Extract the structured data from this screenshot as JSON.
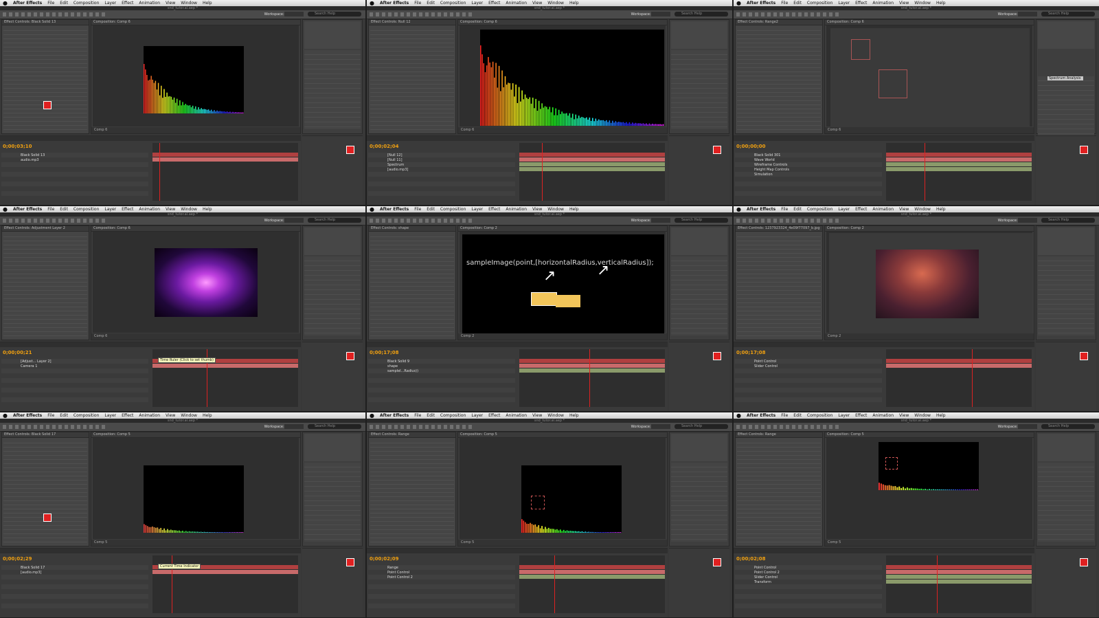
{
  "menu": {
    "app_name": "After Effects",
    "items": [
      "File",
      "Edit",
      "Composition",
      "Layer",
      "Effect",
      "Animation",
      "View",
      "Window",
      "Help"
    ]
  },
  "window_title": "snd_tutor.al.aep *",
  "workspace": "Workspace: Standard",
  "search_placeholder": "Search Help",
  "tiles": [
    {
      "left_tab": "Effect Controls: Black Solid 13",
      "comp_tab": "Composition: Comp 6",
      "comp_name": "Comp 6",
      "timecode": "0;00;03;10",
      "layers": [
        "Black Solid 13",
        "audio.mp3"
      ],
      "viewer": "spectrum-small"
    },
    {
      "left_tab": "Effect Controls: Null 12",
      "comp_tab": "Composition: Comp 6",
      "comp_name": "Comp 6",
      "timecode": "0;00;02;04",
      "layers": [
        "[Null 12]",
        "[Null 11]",
        "Spectrum",
        "[audio.mp3]"
      ],
      "viewer": "spectrum-large"
    },
    {
      "left_tab": "Effect Controls: Range2",
      "comp_tab": "Composition: Comp 6",
      "comp_name": "Comp 6",
      "timecode": "0;00;00;00",
      "layers": [
        "Black Solid 301",
        "Wave World",
        "Wireframe Controls",
        "Height Map Controls",
        "Simulation"
      ],
      "viewer": "gray-boxes",
      "preset": "Spectrum Analysis"
    },
    {
      "left_tab": "Effect Controls: Adjustment Layer 2",
      "comp_tab": "Composition: Comp 6",
      "comp_name": "Comp 6",
      "timecode": "0;00;00;21",
      "layers": [
        "[Adjust... Layer 2]",
        "Camera 1"
      ],
      "viewer": "glow",
      "tooltip": "Time Ruler (Click to set thumb)"
    },
    {
      "left_tab": "Effect Controls: shape",
      "comp_tab": "Composition: Comp 2",
      "comp_name": "Comp 2",
      "timecode": "0;00;17;08",
      "layers": [
        "Black Solid 9",
        "shape",
        "sampleI...Radius))"
      ],
      "viewer": "expression",
      "expression_text": "sampleImage(point,[horizontalRadius,verticalRadius]);"
    },
    {
      "left_tab": "Effect Controls: 1237923324_4e09f77097_b.jpg",
      "comp_tab": "Composition: Comp 2",
      "comp_name": "Comp 2",
      "timecode": "0;00;17;08",
      "layers": [
        "Point Control",
        "Slider Control"
      ],
      "viewer": "sky"
    },
    {
      "left_tab": "Effect Controls: Black Solid 17",
      "comp_tab": "Composition: Comp 5",
      "comp_name": "Comp 5",
      "timecode": "0;00;02;29",
      "layers": [
        "Black Solid 17",
        "[audio.mp3]"
      ],
      "viewer": "dark-spectrum",
      "tooltip": "Current Time Indicator"
    },
    {
      "left_tab": "Effect Controls: Range",
      "comp_tab": "Composition: Comp 5",
      "comp_name": "Comp 5",
      "timecode": "0;00;02;09",
      "layers": [
        "Range",
        "Point Control",
        "Point Control 2"
      ],
      "viewer": "points-spectrum"
    },
    {
      "left_tab": "Effect Controls: Range",
      "comp_tab": "Composition: Comp 5",
      "comp_name": "Comp 5",
      "timecode": "0;00;02;08",
      "layers": [
        "Point Control",
        "Point Control 2",
        "Slider Control",
        "Transform"
      ],
      "viewer": "small-frame"
    }
  ],
  "colors": {
    "accent": "#f0a010",
    "playhead": "#dd2222",
    "swatch": "#e02020"
  }
}
